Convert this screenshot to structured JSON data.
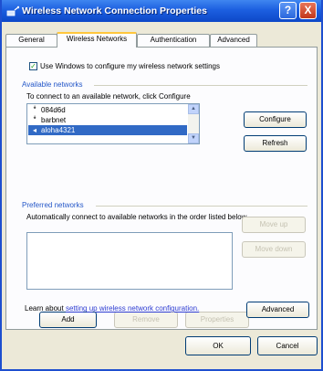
{
  "window": {
    "title": "Wireless Network Connection Properties",
    "help_label": "?",
    "close_label": "X"
  },
  "tabs": [
    {
      "label": "General"
    },
    {
      "label": "Wireless Networks"
    },
    {
      "label": "Authentication"
    },
    {
      "label": "Advanced"
    }
  ],
  "wireless_tab": {
    "use_windows_checkbox": {
      "label": "Use Windows to configure my wireless network settings",
      "checked": true
    },
    "available_networks": {
      "group_label": "Available networks",
      "instruction": "To connect to an available network, click Configure",
      "networks": [
        {
          "name": "084d6d",
          "icon": "antenna-icon",
          "selected": false
        },
        {
          "name": "barbnet",
          "icon": "antenna-icon",
          "selected": false
        },
        {
          "name": "aloha4321",
          "icon": "connected-network-icon",
          "selected": true
        }
      ],
      "configure_label": "Configure",
      "refresh_label": "Refresh"
    },
    "preferred_networks": {
      "group_label": "Preferred networks",
      "instruction": "Automatically connect to available networks in the order listed below",
      "move_up_label": "Move up",
      "move_down_label": "Move down",
      "add_label": "Add",
      "remove_label": "Remove",
      "properties_label": "Properties"
    },
    "learn_prefix": "Learn about",
    "learn_link": "setting up wireless network configuration.",
    "advanced_label": "Advanced"
  },
  "footer": {
    "ok_label": "OK",
    "cancel_label": "Cancel"
  },
  "colors": {
    "title_bar": "#1c5fe0",
    "selection": "#316ac5",
    "group_title": "#2457c8",
    "link": "#2d3cd2"
  }
}
